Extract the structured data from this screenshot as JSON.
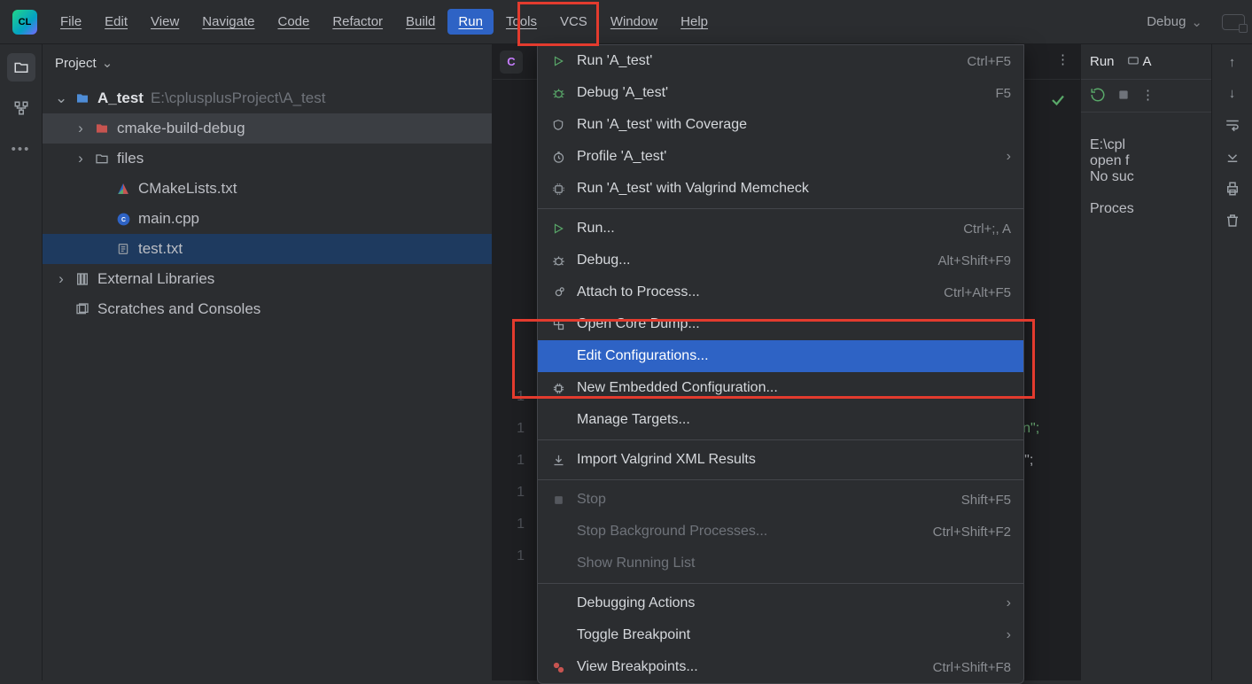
{
  "menu": {
    "file": "File",
    "edit": "Edit",
    "view": "View",
    "navigate": "Navigate",
    "code": "Code",
    "refactor": "Refactor",
    "build": "Build",
    "run": "Run",
    "tools": "Tools",
    "vcs": "VCS",
    "window": "Window",
    "help": "Help"
  },
  "run_config_label": "Debug",
  "project": {
    "panel_title": "Project",
    "root_name": "A_test",
    "root_path": "E:\\cplusplusProject\\A_test",
    "folder_build": "cmake-build-debug",
    "folder_files": "files",
    "file_cmake": "CMakeLists.txt",
    "file_main": "main.cpp",
    "file_test": "test.txt",
    "ext_libs": "External Libraries",
    "scratches": "Scratches and Consoles"
  },
  "dropdown": {
    "run_target": "Run 'A_test'",
    "run_target_short": "Ctrl+F5",
    "debug_target": "Debug 'A_test'",
    "debug_target_short": "F5",
    "coverage": "Run 'A_test' with Coverage",
    "profile": "Profile 'A_test'",
    "valgrind": "Run 'A_test' with Valgrind Memcheck",
    "run": "Run...",
    "run_short": "Ctrl+;, A",
    "debug": "Debug...",
    "debug_short": "Alt+Shift+F9",
    "attach": "Attach to Process...",
    "attach_short": "Ctrl+Alt+F5",
    "open_core": "Open Core Dump...",
    "edit_config": "Edit Configurations...",
    "new_embedded": "New Embedded Configuration...",
    "manage_targets": "Manage Targets...",
    "import_valgrind": "Import Valgrind XML Results",
    "stop": "Stop",
    "stop_short": "Shift+F5",
    "stop_bg": "Stop Background Processes...",
    "stop_bg_short": "Ctrl+Shift+F2",
    "show_running": "Show Running List",
    "debug_actions": "Debugging Actions",
    "toggle_bp": "Toggle Breakpoint",
    "view_bp": "View Breakpoints...",
    "view_bp_short": "Ctrl+Shift+F8"
  },
  "editor": {
    "visible_code_fragment_1": "\"\\n\";",
    "visible_code_fragment_2": "<< \"\\n\";",
    "line_numbers": [
      "1",
      "1",
      "1",
      "1",
      "1",
      "1"
    ]
  },
  "run_panel": {
    "tab_run": "Run",
    "tab_a": "A",
    "out_line1": "E:\\cpl",
    "out_line2": "open f",
    "out_line3": "No suc",
    "out_line4": "",
    "out_line5": "Proces"
  }
}
